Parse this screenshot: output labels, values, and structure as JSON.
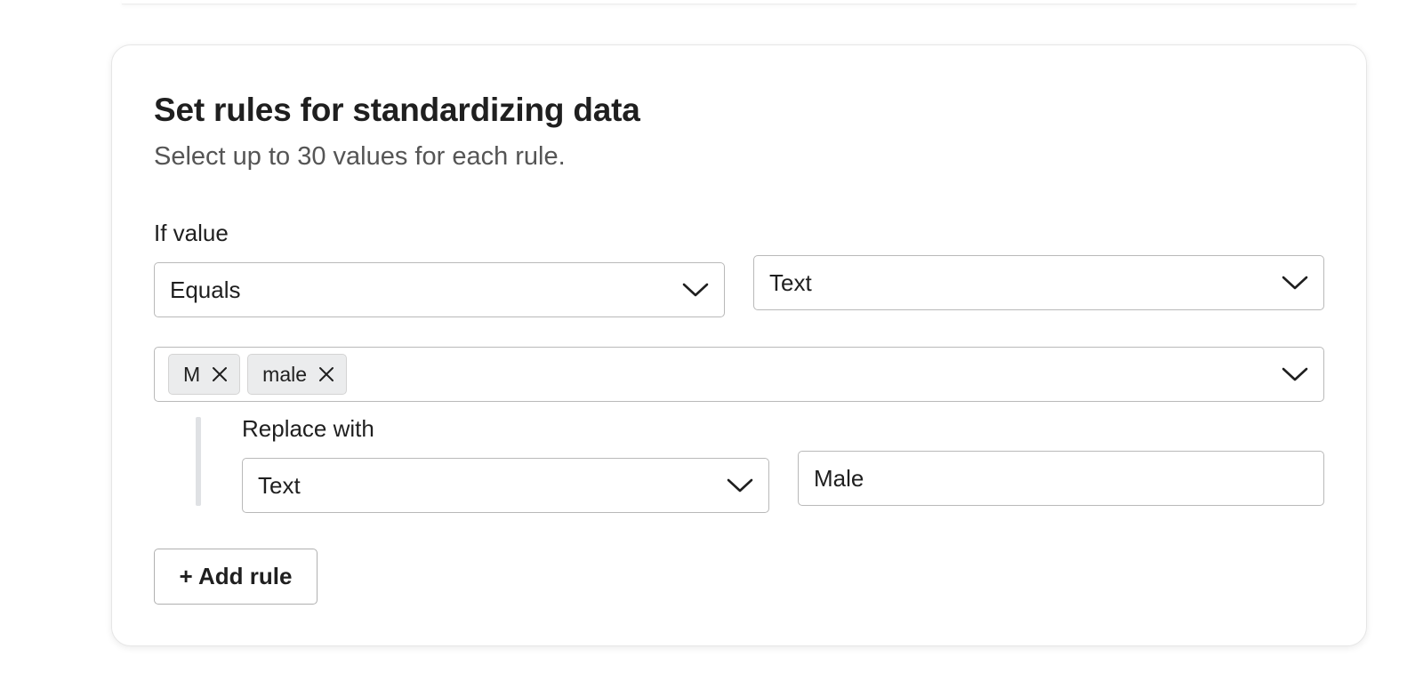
{
  "card": {
    "title": "Set rules for standardizing data",
    "subtitle": "Select up to 30 values for each rule."
  },
  "rule": {
    "if_label": "If value",
    "operator": {
      "selected": "Equals"
    },
    "match_type": {
      "selected": "Text"
    },
    "values": [
      {
        "label": "M"
      },
      {
        "label": "male"
      }
    ],
    "replace": {
      "label": "Replace with",
      "type": {
        "selected": "Text"
      },
      "value": "Male"
    }
  },
  "actions": {
    "add_rule_label": "+ Add rule"
  },
  "icons": {
    "dropdown": "chevron-down-icon",
    "remove": "close-icon"
  },
  "colors": {
    "border": "#b9b9b9",
    "chip_bg": "#ebeced",
    "text": "#1f1f1f",
    "muted_text": "#555555"
  }
}
